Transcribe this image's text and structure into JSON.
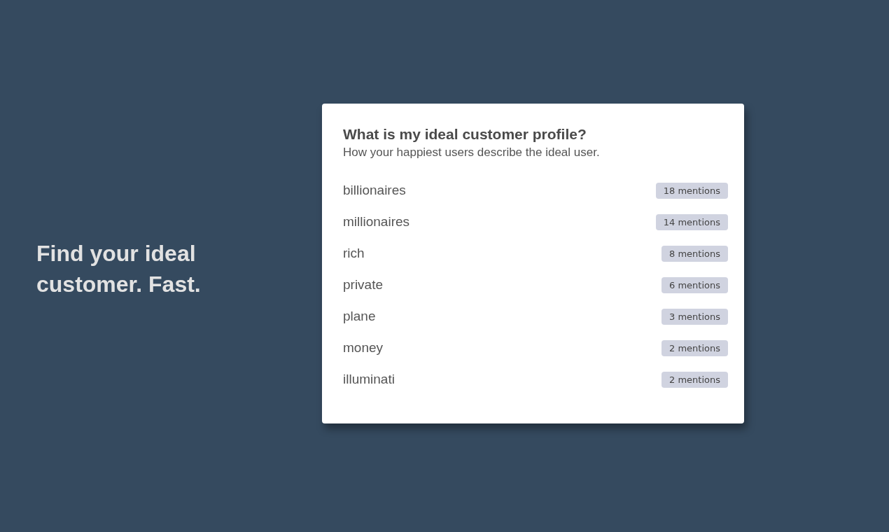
{
  "headline": "Find your ideal customer. Fast.",
  "card": {
    "title": "What is my ideal customer profile?",
    "subtitle": "How your happiest users describe the ideal user.",
    "items": [
      {
        "term": "billionaires",
        "mentions": "18 mentions"
      },
      {
        "term": "millionaires",
        "mentions": "14 mentions"
      },
      {
        "term": "rich",
        "mentions": "8 mentions"
      },
      {
        "term": "private",
        "mentions": "6 mentions"
      },
      {
        "term": "plane",
        "mentions": "3 mentions"
      },
      {
        "term": "money",
        "mentions": "2 mentions"
      },
      {
        "term": "illuminati",
        "mentions": "2 mentions"
      }
    ]
  }
}
